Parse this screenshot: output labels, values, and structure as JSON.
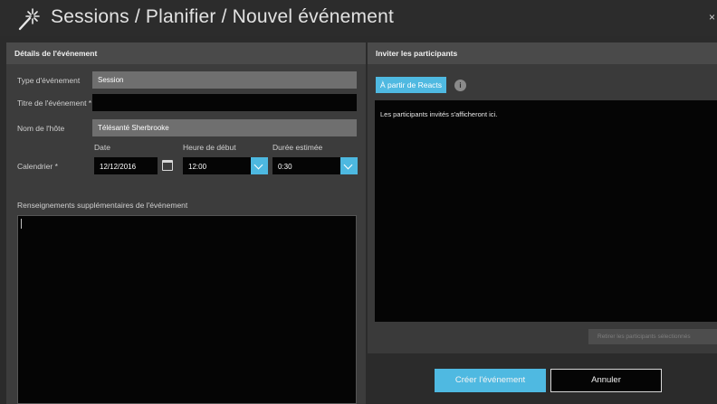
{
  "window": {
    "title": "Sessions / Planifier / Nouvel événement",
    "icon": "magic-wand-icon",
    "close_label": "×"
  },
  "details": {
    "header": "Détails de l'événement",
    "type_label": "Type d'événement",
    "type_value": "Session",
    "title_label": "Titre de l'événement *",
    "title_value": "",
    "host_label": "Nom de l'hôte",
    "host_value": "Télésanté Sherbrooke",
    "date_header": "Date",
    "start_header": "Heure de début",
    "duration_header": "Durée estimée",
    "calendar_label": "Calendrier *",
    "date_value": "12/12/2016",
    "start_value": "12:00",
    "duration_value": "0:30",
    "extra_label": "Renseignements supplémentaires de l'événement",
    "extra_value": ""
  },
  "invite": {
    "header": "Inviter les participants",
    "from_reacts_label": "À partir de Reacts",
    "info_label": "i",
    "placeholder": "Les participants invités s'afficheront ici.",
    "remove_label": "Retirer les participants sélectionnés"
  },
  "actions": {
    "create_label": "Créer l'événement",
    "cancel_label": "Annuler"
  },
  "colors": {
    "accent": "#4fb9e1",
    "background": "#2b2b2b",
    "panel": "#3c3c3c",
    "field_dark": "#050505",
    "field_gray": "#6f6f6f"
  }
}
